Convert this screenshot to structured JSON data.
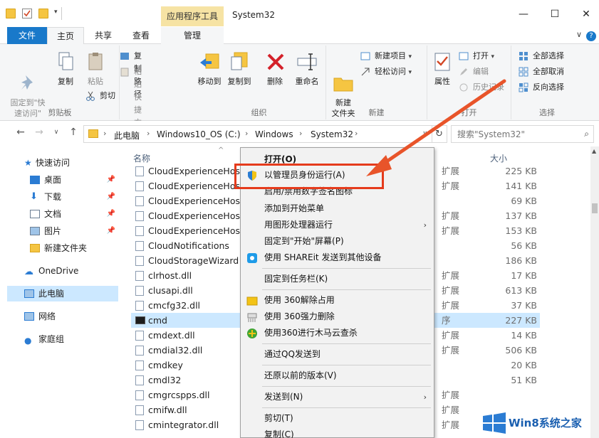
{
  "titlebar": {
    "contextual_tab": "应用程序工具",
    "title": "System32",
    "minimize": "—",
    "maximize": "☐",
    "close": "✕"
  },
  "tabs": {
    "file": "文件",
    "home": "主页",
    "share": "共享",
    "view": "查看",
    "manage": "管理",
    "help": "?",
    "collapse": "∨"
  },
  "ribbon": {
    "clipboard": {
      "label": "剪贴板",
      "pin_quick": "固定到\"快\n速访问\"",
      "copy": "复制",
      "paste": "粘贴",
      "copy_path": "复制路径",
      "paste_shortcut": "粘贴快捷方式",
      "cut": "剪切"
    },
    "organize": {
      "label": "组织",
      "move_to": "移动到",
      "copy_to": "复制到",
      "delete": "删除",
      "rename": "重命名"
    },
    "new": {
      "label": "新建",
      "new_folder": "新建\n文件夹",
      "new_item": "新建项目",
      "easy_access": "轻松访问"
    },
    "open": {
      "label": "打开",
      "properties": "属性",
      "open": "打开",
      "edit": "编辑",
      "history": "历史记录"
    },
    "select": {
      "label": "选择",
      "select_all": "全部选择",
      "select_none": "全部取消",
      "invert": "反向选择"
    }
  },
  "address": {
    "crumbs": [
      "此电脑",
      "Windows10_OS (C:)",
      "Windows",
      "System32"
    ],
    "search_placeholder": "搜索\"System32\""
  },
  "navpane": {
    "quick_access": "快速访问",
    "desktop": "桌面",
    "downloads": "下载",
    "documents": "文档",
    "pictures": "图片",
    "new_folder": "新建文件夹",
    "onedrive": "OneDrive",
    "this_pc": "此电脑",
    "network": "网络",
    "homegroup": "家庭组"
  },
  "filelist": {
    "col_name": "名称",
    "col_size": "大小",
    "files": [
      {
        "name": "CloudExperienceHos",
        "type": "扩展",
        "size": "225 KB"
      },
      {
        "name": "CloudExperienceHos",
        "type": "扩展",
        "size": "141 KB"
      },
      {
        "name": "CloudExperienceHostE",
        "type": "",
        "size": "69 KB"
      },
      {
        "name": "CloudExperienceHost(",
        "type": "扩展",
        "size": "137 KB"
      },
      {
        "name": "CloudExperienceHostU",
        "type": "扩展",
        "size": "153 KB"
      },
      {
        "name": "CloudNotifications",
        "type": "",
        "size": "56 KB"
      },
      {
        "name": "CloudStorageWizard",
        "type": "",
        "size": "186 KB"
      },
      {
        "name": "clrhost.dll",
        "type": "扩展",
        "size": "17 KB"
      },
      {
        "name": "clusapi.dll",
        "type": "扩展",
        "size": "613 KB"
      },
      {
        "name": "cmcfg32.dll",
        "type": "扩展",
        "size": "37 KB"
      },
      {
        "name": "cmd",
        "type": "序",
        "size": "227 KB"
      },
      {
        "name": "cmdext.dll",
        "type": "扩展",
        "size": "14 KB"
      },
      {
        "name": "cmdial32.dll",
        "type": "扩展",
        "size": "506 KB"
      },
      {
        "name": "cmdkey",
        "type": "",
        "size": "20 KB"
      },
      {
        "name": "cmdl32",
        "type": "",
        "size": "51 KB"
      },
      {
        "name": "cmgrcspps.dll",
        "type": "扩展",
        "size": ""
      },
      {
        "name": "cmifw.dll",
        "type": "扩展",
        "size": ""
      },
      {
        "name": "cmintegrator.dll",
        "type": "扩展",
        "size": ""
      }
    ]
  },
  "context_menu": {
    "open": "打开(O)",
    "run_as_admin": "以管理员身份运行(A)",
    "toggle_signature": "启用/禁用数字签名图标",
    "add_to_start": "添加到开始菜单",
    "run_with_gpu": "用图形处理器运行",
    "pin_to_start": "固定到\"开始\"屏幕(P)",
    "shareit": "使用 SHAREit 发送到其他设备",
    "pin_to_taskbar": "固定到任务栏(K)",
    "unlock_360": "使用 360解除占用",
    "force_delete_360": "使用 360强力删除",
    "trojan_scan_360": "使用360进行木马云查杀",
    "send_via_qq": "通过QQ发送到",
    "restore_previous": "还原以前的版本(V)",
    "send_to": "发送到(N)",
    "cut": "剪切(T)",
    "copy": "复制(C)",
    "submenu_arrow": "›"
  },
  "watermark": {
    "text": "Win8系统之家"
  },
  "colors": {
    "accent": "#1979ca",
    "highlight": "#e53b1c",
    "selection": "#cce8ff",
    "contextual_tab": "#f6e3a4"
  }
}
